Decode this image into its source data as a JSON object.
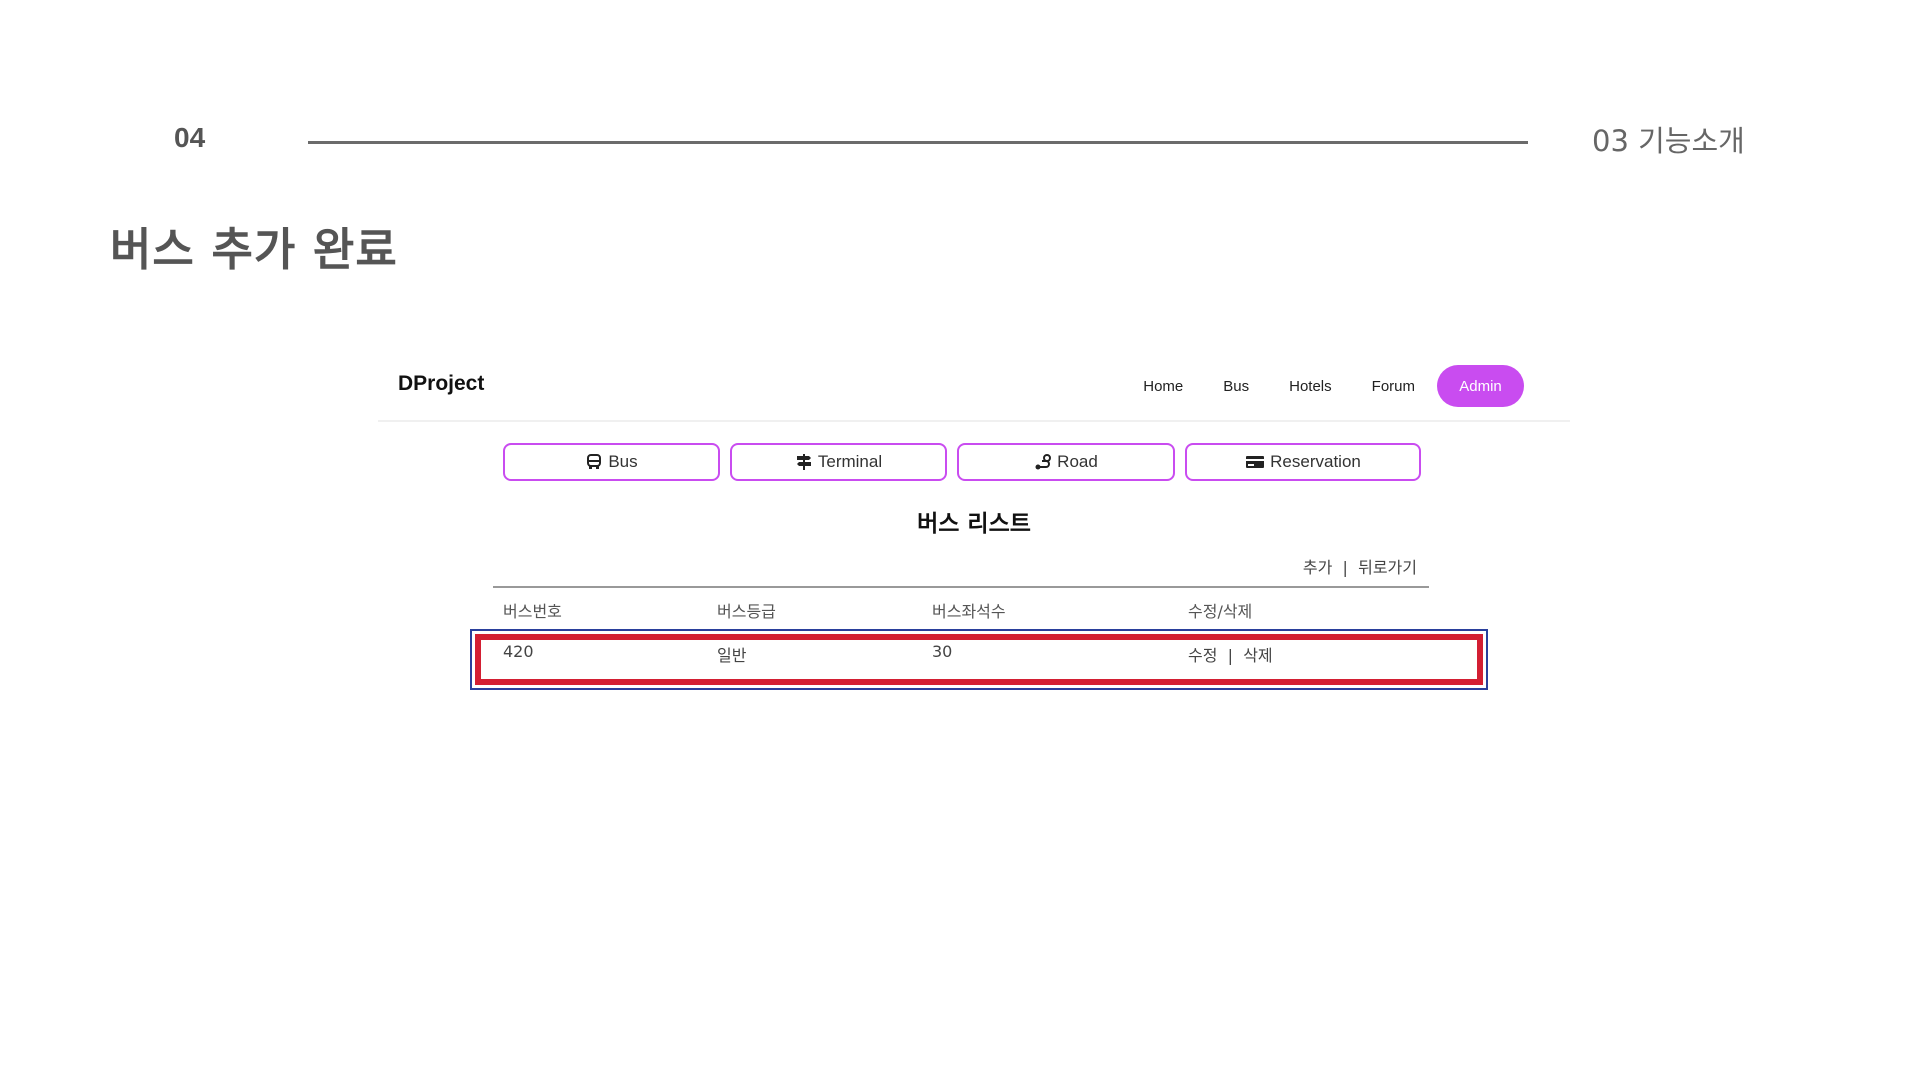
{
  "slide": {
    "number": "04",
    "section": "03 기능소개",
    "title": "버스 추가 완료"
  },
  "app": {
    "brand": "DProject",
    "nav": [
      "Home",
      "Bus",
      "Hotels",
      "Forum"
    ],
    "nav_active": "Admin",
    "accent_color": "#c94cf0"
  },
  "tabs": [
    {
      "label": "Bus",
      "icon": "bus-icon"
    },
    {
      "label": "Terminal",
      "icon": "signpost-icon"
    },
    {
      "label": "Road",
      "icon": "route-icon"
    },
    {
      "label": "Reservation",
      "icon": "card-icon"
    }
  ],
  "list": {
    "title": "버스 리스트",
    "add_label": "추가",
    "separator": "|",
    "back_label": "뒤로가기",
    "columns": [
      "버스번호",
      "버스등급",
      "버스좌석수",
      "수정/삭제"
    ],
    "rows": [
      {
        "bus_no": "420",
        "grade": "일반",
        "seats": "30",
        "edit": "수정",
        "sep": "|",
        "delete": "삭제"
      }
    ],
    "highlight_color": "#d31f33"
  }
}
